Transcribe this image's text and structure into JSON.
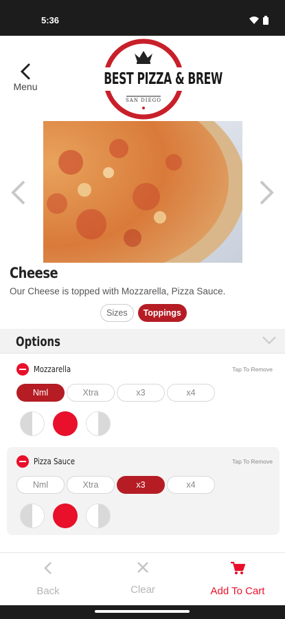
{
  "status_bar": {
    "time": "5:36",
    "icons": [
      "wifi-icon",
      "battery-icon"
    ]
  },
  "header": {
    "back_label": "Menu",
    "logo": {
      "line1": "BEST PIZZA & BREW",
      "line2": "SAN DIEGO"
    }
  },
  "item": {
    "title": "Cheese",
    "description": "Our Cheese is topped with Mozzarella, Pizza Sauce."
  },
  "tabs": [
    {
      "label": "Sizes",
      "selected": false
    },
    {
      "label": "Toppings",
      "selected": true
    }
  ],
  "options": {
    "title": "Options",
    "toppings": [
      {
        "name": "Mozzarella",
        "hint": "Tap To Remove",
        "amounts": [
          {
            "label": "Nml",
            "selected": true
          },
          {
            "label": "Xtra",
            "selected": false
          },
          {
            "label": "x3",
            "selected": false
          },
          {
            "label": "x4",
            "selected": false
          }
        ],
        "coverage": [
          "left-half",
          "whole",
          "right-half"
        ],
        "coverage_selected": "whole"
      },
      {
        "name": "Pizza Sauce",
        "hint": "Tap To Remove",
        "amounts": [
          {
            "label": "Nml",
            "selected": false
          },
          {
            "label": "Xtra",
            "selected": false
          },
          {
            "label": "x3",
            "selected": true
          },
          {
            "label": "x4",
            "selected": false
          }
        ],
        "coverage": [
          "left-half",
          "whole",
          "right-half"
        ],
        "coverage_selected": "whole"
      }
    ]
  },
  "bottom_nav": {
    "back": "Back",
    "clear": "Clear",
    "add_to_cart": "Add To Cart"
  },
  "colors": {
    "brand_red": "#b51c24",
    "accent_red": "#e8102a",
    "status_bar": "#1c1c1c"
  }
}
